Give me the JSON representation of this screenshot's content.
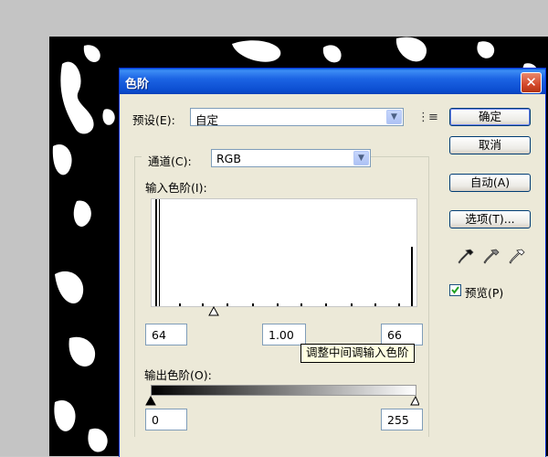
{
  "dialog": {
    "title": "色阶",
    "preset_label": "预设(E):",
    "preset_value": "自定",
    "channel_label": "通道(C):",
    "channel_value": "RGB",
    "input_levels_label": "输入色阶(I):",
    "input_values": {
      "black": "64",
      "mid": "1.00",
      "white": "66"
    },
    "tooltip": "调整中间调输入色阶",
    "output_levels_label": "输出色阶(O):",
    "output_values": {
      "black": "0",
      "white": "255"
    },
    "buttons": {
      "ok": "确定",
      "cancel": "取消",
      "auto": "自动(A)",
      "options": "选项(T)..."
    },
    "preview_label": "预览(P)",
    "preview_checked": true
  },
  "icons": {
    "close": "close-icon",
    "menu": "options-menu-icon",
    "eyedroppers": [
      "black-eyedropper-icon",
      "gray-eyedropper-icon",
      "white-eyedropper-icon"
    ]
  },
  "colors": {
    "titlebar": "#0a4ccf",
    "dialog_bg": "#ece9d8",
    "close": "#d4482c"
  }
}
